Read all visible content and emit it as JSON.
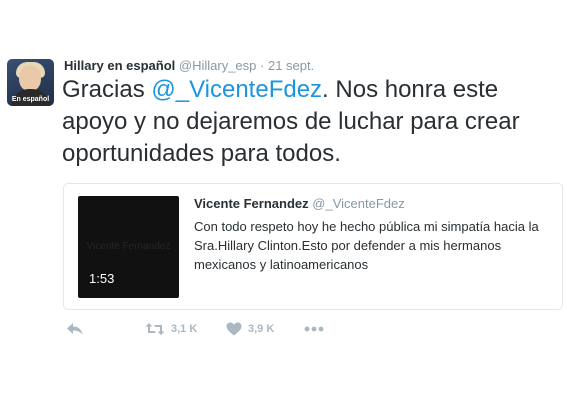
{
  "author": {
    "name": "Hillary en español",
    "handle": "@Hillary_esp",
    "separator": "·",
    "date": "21 sept.",
    "avatar_label": "En español"
  },
  "tweet": {
    "text_before": "Gracias ",
    "mention": "@_VicenteFdez",
    "text_after": ". Nos honra este apoyo y no dejaremos de luchar para crear oportunidades para todos."
  },
  "quoted": {
    "name": "Vicente Fernandez",
    "handle": "@_VicenteFdez",
    "text": "Con todo respeto hoy he hecho pública mi simpatía hacia la Sra.Hillary Clinton.Esto por defender a mis hermanos mexicanos y latinoamericanos",
    "video_duration": "1:53",
    "video_ghost_text": "Vicente Fernandez"
  },
  "actions": {
    "reply_icon": "reply-icon",
    "retweet_icon": "retweet-icon",
    "retweet_count": "3,1 K",
    "like_icon": "heart-icon",
    "like_count": "3,9 K",
    "more_icon": "more-icon"
  },
  "colors": {
    "link": "#1b95e0",
    "muted": "#8899a6",
    "action": "#aab8c2",
    "text": "#292f33"
  }
}
